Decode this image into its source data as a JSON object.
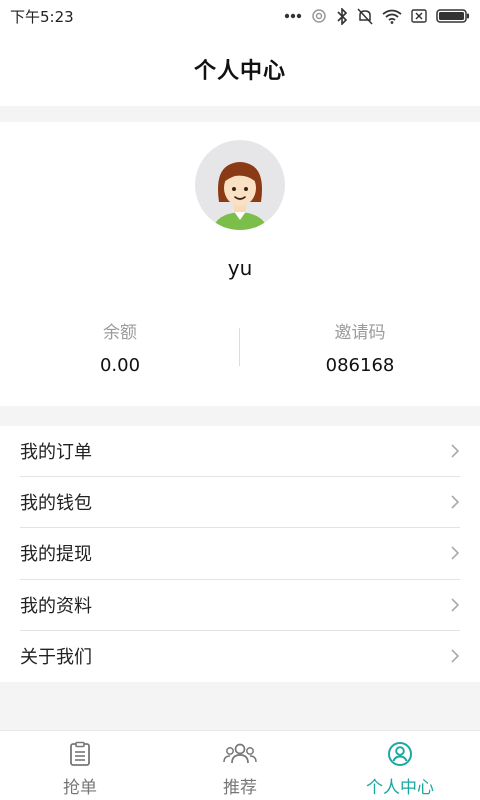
{
  "status_bar": {
    "time": "下午5:23"
  },
  "header": {
    "title": "个人中心"
  },
  "profile": {
    "username": "yu",
    "stats": [
      {
        "label": "余额",
        "value": "0.00"
      },
      {
        "label": "邀请码",
        "value": "086168"
      }
    ]
  },
  "menu": {
    "items": [
      {
        "label": "我的订单"
      },
      {
        "label": "我的钱包"
      },
      {
        "label": "我的提现"
      },
      {
        "label": "我的资料"
      },
      {
        "label": "关于我们"
      }
    ]
  },
  "tabbar": {
    "tabs": [
      {
        "label": "抢单",
        "icon": "clipboard-list-icon"
      },
      {
        "label": "推荐",
        "icon": "group-icon"
      },
      {
        "label": "个人中心",
        "icon": "user-circle-icon",
        "active": true
      }
    ],
    "active_color": "#1aa8a0",
    "inactive_color": "#777777"
  }
}
